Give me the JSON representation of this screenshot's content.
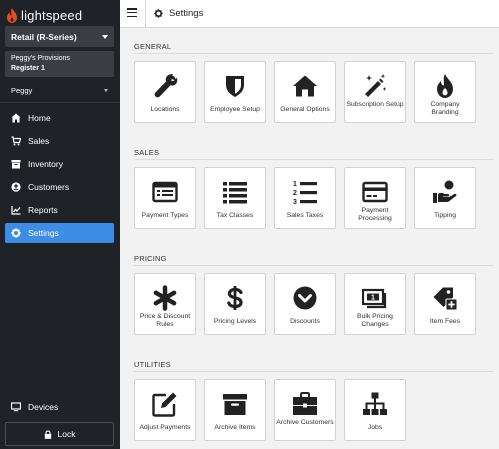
{
  "brand": {
    "name": "lightspeed",
    "accent": "#e94e1b"
  },
  "sidebar": {
    "retail_select": "Retail (R-Series)",
    "shop_name": "Peggy's Provisions",
    "register_name": "Register 1",
    "user_name": "Peggy",
    "items": [
      {
        "label": "Home",
        "icon": "home-icon"
      },
      {
        "label": "Sales",
        "icon": "sales-icon"
      },
      {
        "label": "Inventory",
        "icon": "inventory-icon"
      },
      {
        "label": "Customers",
        "icon": "customers-icon"
      },
      {
        "label": "Reports",
        "icon": "reports-icon"
      },
      {
        "label": "Settings",
        "icon": "gear-icon",
        "active": true
      }
    ],
    "devices_label": "Devices",
    "lock_label": "Lock",
    "active_color": "#3d8de6"
  },
  "header": {
    "title": "Settings"
  },
  "sections": {
    "general": {
      "label": "GENERAL",
      "tiles": [
        {
          "label": "Locations",
          "icon": "wrench-icon"
        },
        {
          "label": "Employee Setup",
          "icon": "shield-icon"
        },
        {
          "label": "General Options",
          "icon": "house-icon"
        },
        {
          "label": "Subscription Setup",
          "icon": "magic-wand-icon"
        },
        {
          "label": "Company Branding",
          "icon": "flame-icon"
        }
      ]
    },
    "sales": {
      "label": "SALES",
      "tiles": [
        {
          "label": "Payment Types",
          "icon": "payment-types-icon"
        },
        {
          "label": "Tax Classes",
          "icon": "list-icon"
        },
        {
          "label": "Sales Taxes",
          "icon": "numbered-list-icon"
        },
        {
          "label": "Payment Processing",
          "icon": "credit-card-icon"
        },
        {
          "label": "Tipping",
          "icon": "tipping-hand-icon"
        }
      ]
    },
    "pricing": {
      "label": "PRICING",
      "tiles": [
        {
          "label": "Price & Discount Rules",
          "icon": "asterisk-icon"
        },
        {
          "label": "Pricing Levels",
          "icon": "dollar-icon"
        },
        {
          "label": "Discounts",
          "icon": "chevron-circle-icon"
        },
        {
          "label": "Bulk Pricing Changes",
          "icon": "bulk-money-icon"
        },
        {
          "label": "Item Fees",
          "icon": "tag-plus-icon"
        }
      ]
    },
    "utilities": {
      "label": "UTILITIES",
      "tiles": [
        {
          "label": "Adjust Payments",
          "icon": "edit-icon"
        },
        {
          "label": "Archive Items",
          "icon": "archive-box-icon"
        },
        {
          "label": "Archive Customers",
          "icon": "briefcase-icon"
        },
        {
          "label": "Jobs",
          "icon": "sitemap-icon"
        }
      ]
    }
  }
}
